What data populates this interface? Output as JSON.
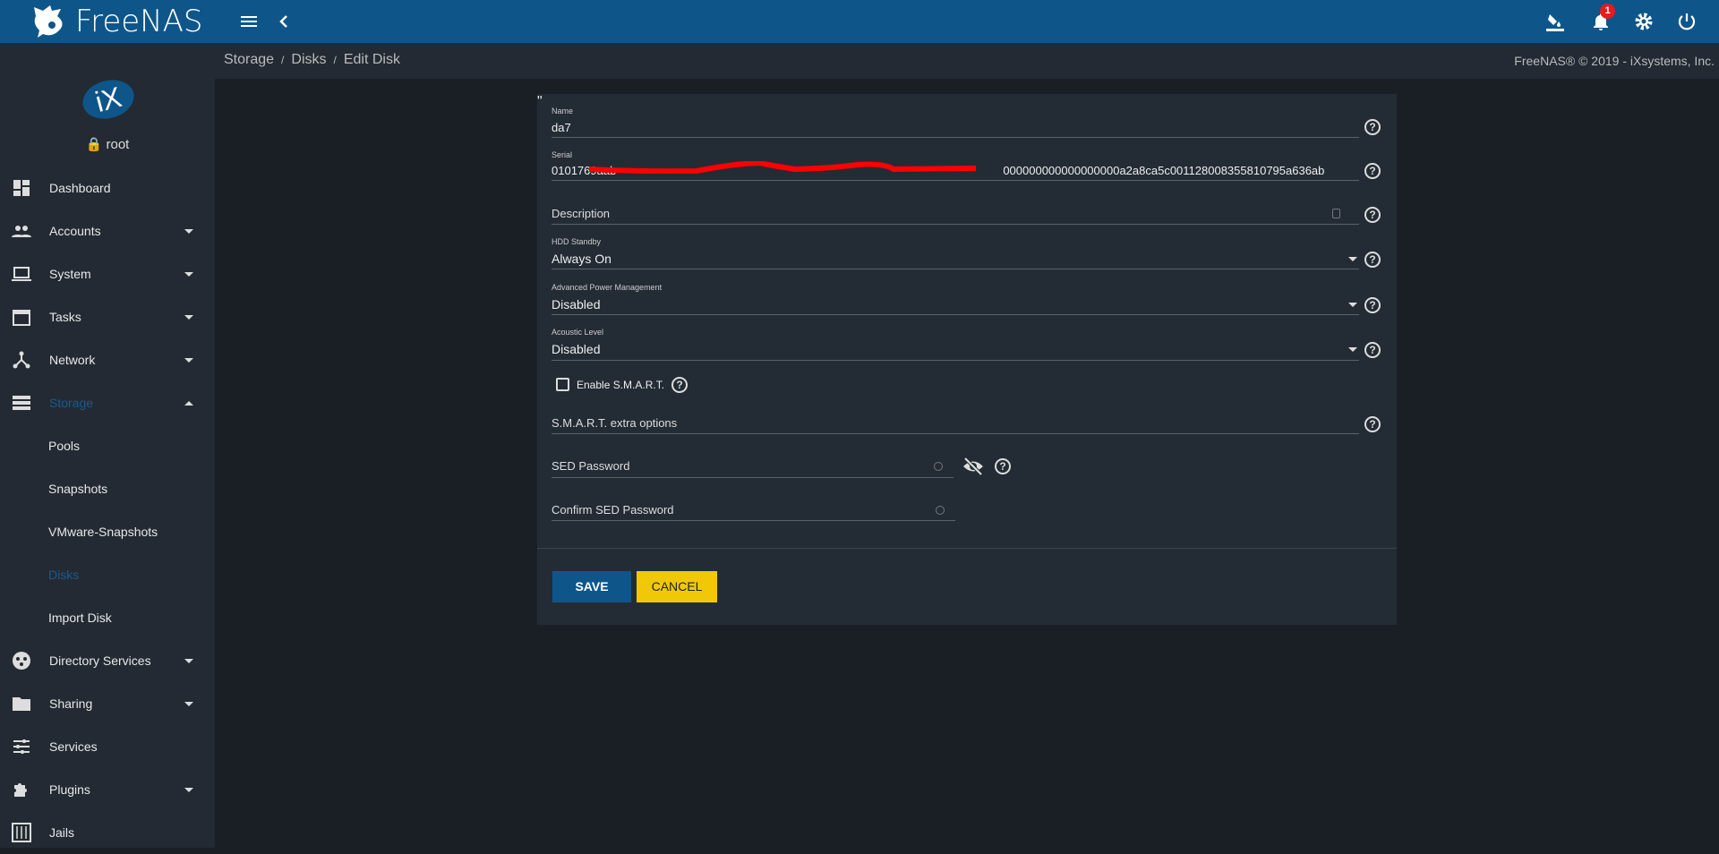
{
  "app": {
    "logo_text": "FreeNAS",
    "notification_count": "1",
    "copyright": "FreeNAS® © 2019 - iXsystems, Inc."
  },
  "user": {
    "name": "root",
    "logo_text": "iX"
  },
  "breadcrumb": [
    "Storage",
    "Disks",
    "Edit Disk"
  ],
  "sidebar": {
    "items": [
      {
        "label": "Dashboard"
      },
      {
        "label": "Accounts"
      },
      {
        "label": "System"
      },
      {
        "label": "Tasks"
      },
      {
        "label": "Network"
      },
      {
        "label": "Storage"
      },
      {
        "label": "Pools"
      },
      {
        "label": "Snapshots"
      },
      {
        "label": "VMware-Snapshots"
      },
      {
        "label": "Disks"
      },
      {
        "label": "Import Disk"
      },
      {
        "label": "Directory Services"
      },
      {
        "label": "Sharing"
      },
      {
        "label": "Services"
      },
      {
        "label": "Plugins"
      },
      {
        "label": "Jails"
      }
    ]
  },
  "form": {
    "name": {
      "label": "Name",
      "value": "da7"
    },
    "serial": {
      "label": "Serial",
      "value_start": "0101769aab",
      "value_end": "000000000000000000a2a8ca5c001128008355810795a636ab"
    },
    "description": {
      "placeholder": "Description"
    },
    "hdd_standby": {
      "label": "HDD Standby",
      "value": "Always On"
    },
    "apm": {
      "label": "Advanced Power Management",
      "value": "Disabled"
    },
    "acoustic": {
      "label": "Acoustic Level",
      "value": "Disabled"
    },
    "smart": {
      "label": "Enable S.M.A.R.T.",
      "checked": false
    },
    "smart_options": {
      "placeholder": "S.M.A.R.T. extra options"
    },
    "sed_password": {
      "placeholder": "SED Password"
    },
    "confirm_sed_password": {
      "placeholder": "Confirm SED Password"
    },
    "help_glyph": "?",
    "save_label": "SAVE",
    "cancel_label": "CANCEL"
  },
  "colors": {
    "header": "#0e568a",
    "save": "#0e568a",
    "cancel": "#f0c808",
    "badge": "#e8191f"
  }
}
